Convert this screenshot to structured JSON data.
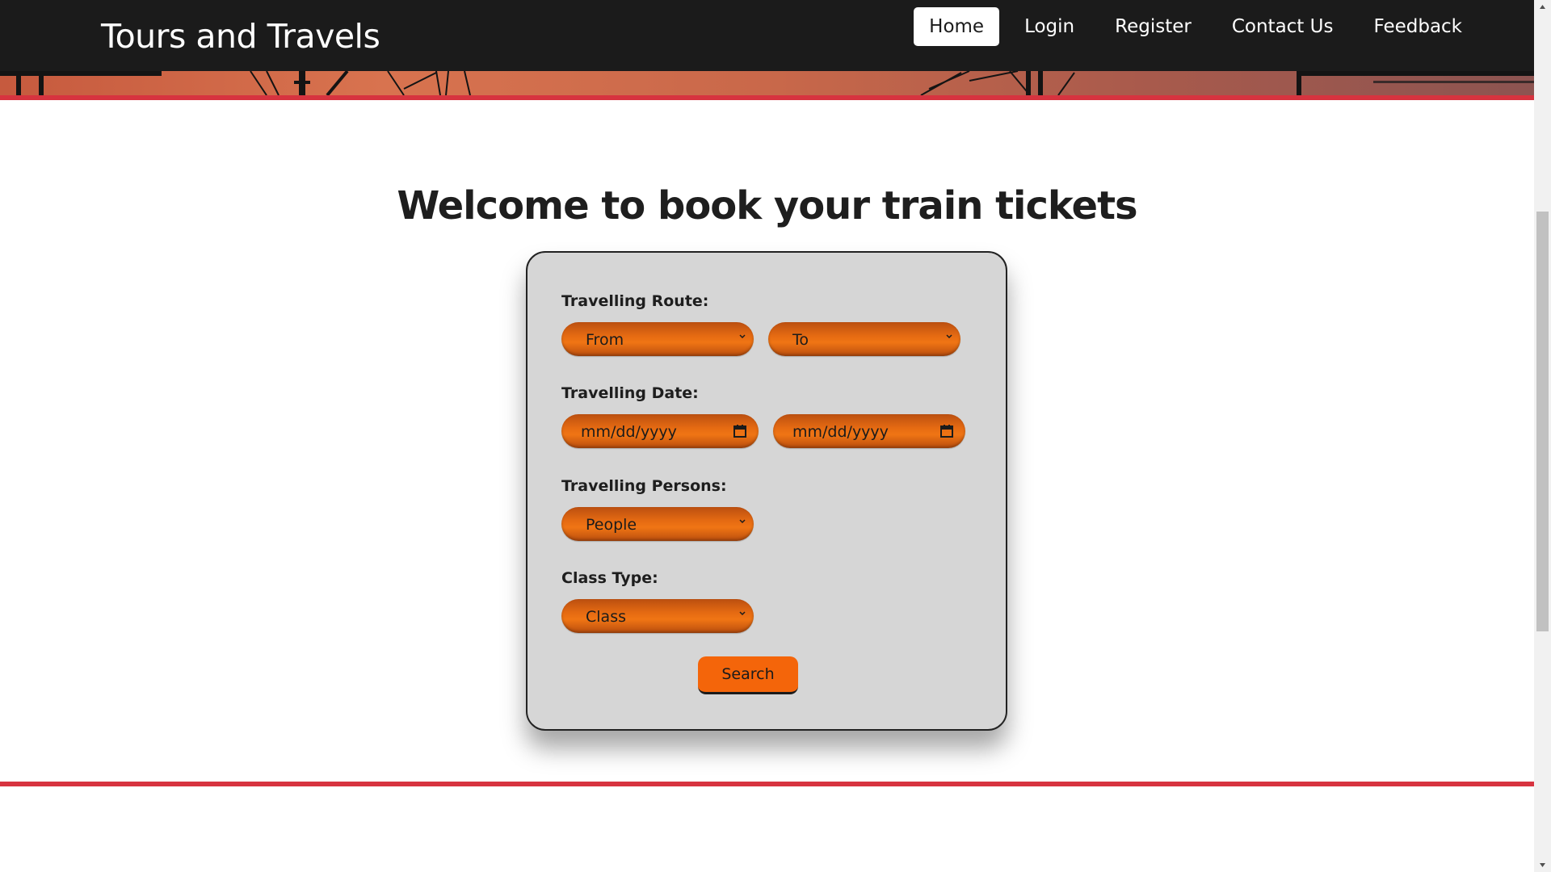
{
  "header": {
    "brand": "Tours and Travels",
    "nav": [
      {
        "label": "Home",
        "active": true
      },
      {
        "label": "Login",
        "active": false
      },
      {
        "label": "Register",
        "active": false
      },
      {
        "label": "Contact Us",
        "active": false
      },
      {
        "label": "Feedback",
        "active": false
      }
    ]
  },
  "main": {
    "heading": "Welcome to book your train tickets",
    "form": {
      "route": {
        "label": "Travelling Route:",
        "from_value": "From",
        "to_value": "To"
      },
      "date": {
        "label": "Travelling Date:",
        "start_value": "mm/dd/yyyy",
        "end_value": "mm/dd/yyyy"
      },
      "persons": {
        "label": "Travelling Persons:",
        "value": "People"
      },
      "class_type": {
        "label": "Class Type:",
        "value": "Class"
      },
      "search_label": "Search"
    }
  },
  "colors": {
    "navbar": "#1b1b1b",
    "accent_line": "#d7333f",
    "pill_orange": "#e56a12",
    "button_orange": "#f4650a",
    "card_bg": "#d6d6d6"
  },
  "icons": [
    "chevron-down-icon",
    "calendar-icon",
    "scroll-up-arrow-icon",
    "scroll-down-arrow-icon"
  ]
}
